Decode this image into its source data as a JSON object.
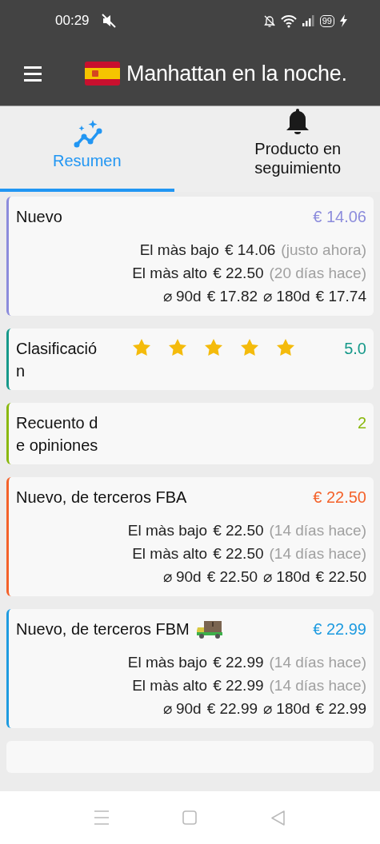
{
  "status_bar": {
    "time": "00:29",
    "battery": "99"
  },
  "app_bar": {
    "title": "Manhattan en la noche."
  },
  "tabs": [
    {
      "label": "Resumen",
      "selected": true,
      "kind": "summary"
    },
    {
      "label": "Producto en seguimiento",
      "selected": false,
      "kind": "tracking"
    }
  ],
  "cards": [
    {
      "kind": "price",
      "title": "Nuevo",
      "color": "#8c8cdc",
      "value": "€ 14.06",
      "shipping_icon": false,
      "history": [
        {
          "label": "El màs bajo",
          "value": "€ 14.06",
          "note": "(justo ahora)"
        },
        {
          "label": "El màs alto",
          "value": "€ 22.50",
          "note": "(20 días hace)"
        }
      ],
      "averages": [
        {
          "label": "⌀ 90d",
          "value": "€ 17.82"
        },
        {
          "label": "⌀ 180d",
          "value": "€ 17.74"
        }
      ]
    },
    {
      "kind": "rating",
      "title": "Clasificación",
      "color": "#16998a",
      "value": "5.0",
      "stars": 5
    },
    {
      "kind": "count",
      "title": "Recuento de opiniones",
      "color": "#8ab80e",
      "value": "2"
    },
    {
      "kind": "price",
      "title": "Nuevo, de terceros FBA",
      "color": "#f4622a",
      "value": "€ 22.50",
      "shipping_icon": false,
      "history": [
        {
          "label": "El màs bajo",
          "value": "€ 22.50",
          "note": "(14 días hace)"
        },
        {
          "label": "El màs alto",
          "value": "€ 22.50",
          "note": "(14 días hace)"
        }
      ],
      "averages": [
        {
          "label": "⌀ 90d",
          "value": "€ 22.50"
        },
        {
          "label": "⌀ 180d",
          "value": "€ 22.50"
        }
      ]
    },
    {
      "kind": "price",
      "title": "Nuevo, de terceros FBM",
      "color": "#1e9be0",
      "value": "€ 22.99",
      "shipping_icon": true,
      "history": [
        {
          "label": "El màs bajo",
          "value": "€ 22.99",
          "note": "(14 días hace)"
        },
        {
          "label": "El màs alto",
          "value": "€ 22.99",
          "note": "(14 días hace)"
        }
      ],
      "averages": [
        {
          "label": "⌀ 90d",
          "value": "€ 22.99"
        },
        {
          "label": "⌀ 180d",
          "value": "€ 22.99"
        }
      ]
    }
  ]
}
